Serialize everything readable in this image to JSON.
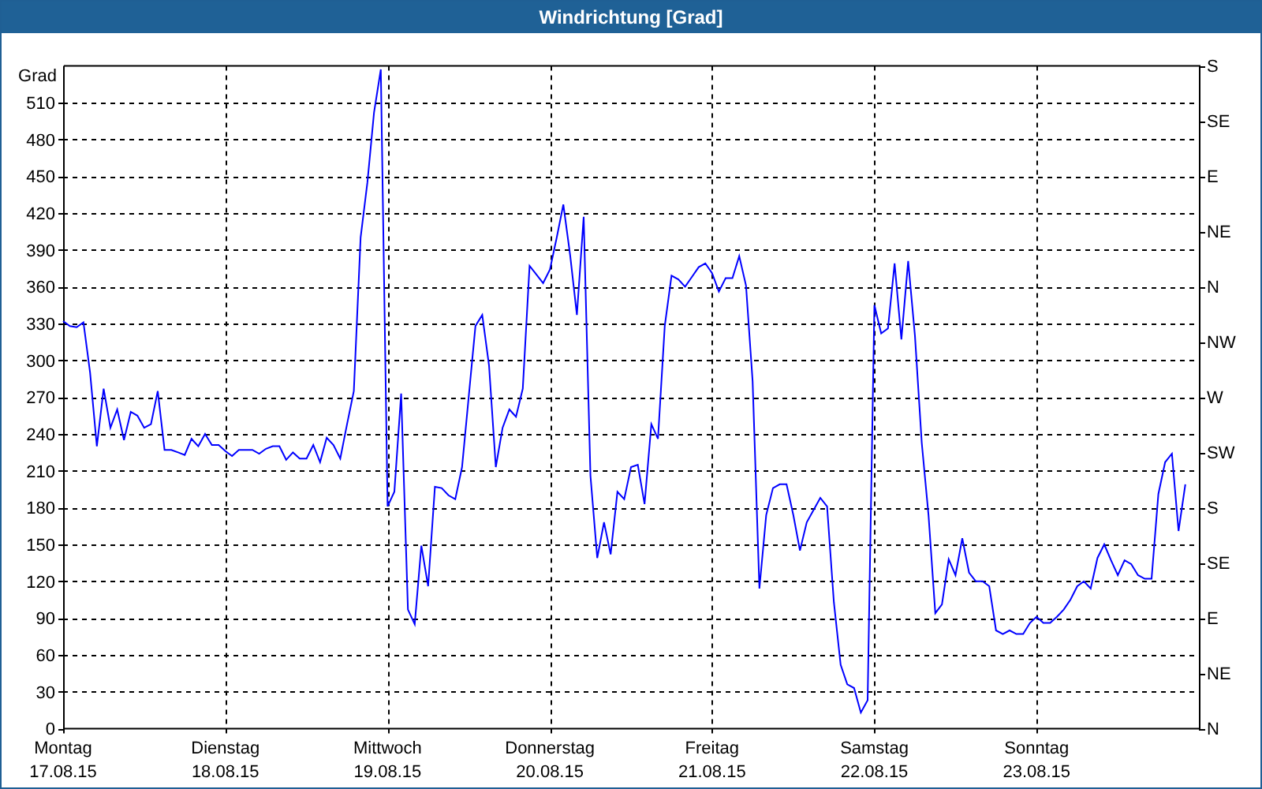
{
  "window": {
    "title": "Windrichtung [Grad]"
  },
  "chart": {
    "compass_labels": [
      "S",
      "SE",
      "E",
      "NE",
      "N",
      "NW",
      "W",
      "SW",
      "S",
      "SE",
      "E",
      "NE",
      "N"
    ],
    "dates": [
      "17.08.15",
      "18.08.15",
      "19.08.15",
      "20.08.15",
      "21.08.15",
      "22.08.15",
      "23.08.15"
    ],
    "chart_data": {
      "type": "line",
      "grid": true,
      "ylabel": "Grad",
      "ylim": [
        0,
        540
      ],
      "yticks": [
        0,
        30,
        60,
        90,
        120,
        150,
        180,
        210,
        240,
        270,
        300,
        330,
        360,
        390,
        420,
        450,
        480,
        510
      ],
      "categories": [
        "Montag",
        null,
        null,
        null,
        null,
        null,
        null,
        null,
        null,
        null,
        null,
        null,
        null,
        null,
        null,
        null,
        null,
        null,
        null,
        null,
        null,
        null,
        null,
        null,
        "Dienstag",
        null,
        null,
        null,
        null,
        null,
        null,
        null,
        null,
        null,
        null,
        null,
        null,
        null,
        null,
        null,
        null,
        null,
        null,
        null,
        null,
        null,
        null,
        null,
        "Mittwoch",
        null,
        null,
        null,
        null,
        null,
        null,
        null,
        null,
        null,
        null,
        null,
        null,
        null,
        null,
        null,
        null,
        null,
        null,
        null,
        null,
        null,
        null,
        null,
        "Donnerstag",
        null,
        null,
        null,
        null,
        null,
        null,
        null,
        null,
        null,
        null,
        null,
        null,
        null,
        null,
        null,
        null,
        null,
        null,
        null,
        null,
        null,
        null,
        null,
        "Freitag",
        null,
        null,
        null,
        null,
        null,
        null,
        null,
        null,
        null,
        null,
        null,
        null,
        null,
        null,
        null,
        null,
        null,
        null,
        null,
        null,
        null,
        null,
        null,
        "Samstag",
        null,
        null,
        null,
        null,
        null,
        null,
        null,
        null,
        null,
        null,
        null,
        null,
        null,
        null,
        null,
        null,
        null,
        null,
        null,
        null,
        null,
        null,
        null,
        "Sonntag",
        null,
        null,
        null,
        null,
        null,
        null,
        null,
        null,
        null,
        null,
        null,
        null,
        null,
        null,
        null,
        null,
        null,
        null,
        null,
        null,
        null,
        null,
        null,
        null
      ],
      "series": [
        {
          "color": "#0000ff",
          "values": [
            332,
            328,
            327,
            331,
            290,
            230,
            277,
            245,
            260,
            235,
            258,
            255,
            245,
            248,
            275,
            227,
            227,
            225,
            223,
            236,
            230,
            240,
            231,
            231,
            226,
            222,
            227,
            227,
            227,
            224,
            228,
            230,
            230,
            219,
            225,
            220,
            220,
            231,
            217,
            237,
            231,
            220,
            248,
            275,
            400,
            445,
            502,
            537,
            181,
            193,
            273,
            97,
            85,
            149,
            116,
            197,
            196,
            190,
            187,
            213,
            270,
            328,
            337,
            296,
            213,
            245,
            260,
            254,
            277,
            377,
            370,
            363,
            374,
            400,
            427,
            386,
            337,
            417,
            206,
            139,
            168,
            142,
            193,
            187,
            213,
            215,
            183,
            248,
            236,
            328,
            369,
            366,
            360,
            368,
            376,
            379,
            371,
            356,
            367,
            367,
            385,
            361,
            283,
            114,
            174,
            196,
            199,
            199,
            174,
            145,
            168,
            178,
            188,
            181,
            103,
            52,
            36,
            33,
            13,
            23,
            345,
            322,
            326,
            379,
            317,
            381,
            320,
            233,
            174,
            94,
            101,
            138,
            125,
            155,
            127,
            120,
            120,
            116,
            80,
            77,
            80,
            77,
            77,
            86,
            91,
            86,
            86,
            91,
            97,
            105,
            116,
            120,
            114,
            139,
            150,
            137,
            125,
            137,
            134,
            125,
            122,
            122,
            191,
            217,
            224,
            161,
            199,
            null,
            null
          ]
        }
      ]
    }
  }
}
